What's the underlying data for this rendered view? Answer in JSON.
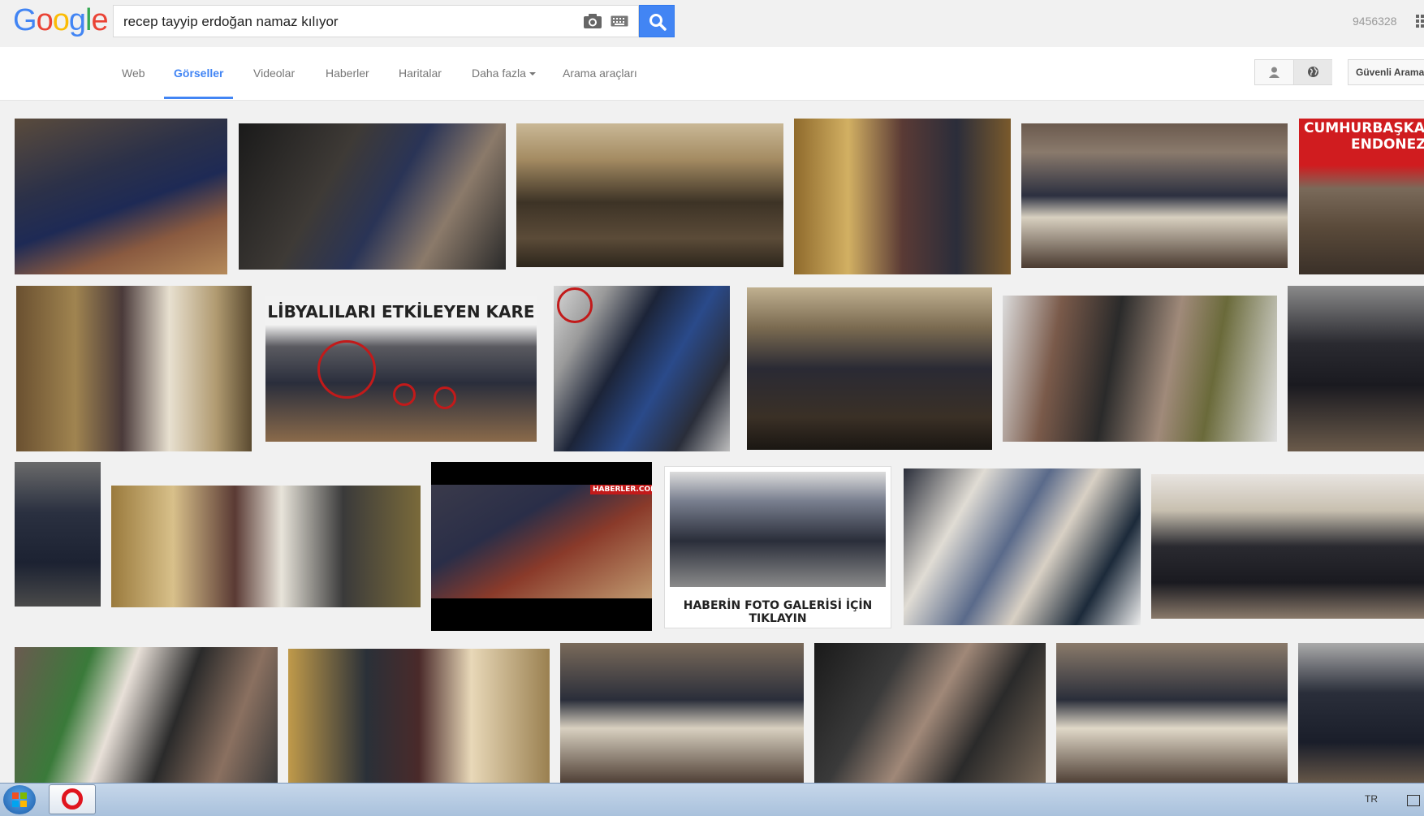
{
  "header": {
    "logo_letters": [
      {
        "ch": "G",
        "color": "#4285f4"
      },
      {
        "ch": "o",
        "color": "#ea4335"
      },
      {
        "ch": "o",
        "color": "#fbbc05"
      },
      {
        "ch": "g",
        "color": "#4285f4"
      },
      {
        "ch": "l",
        "color": "#34a853"
      },
      {
        "ch": "e",
        "color": "#ea4335"
      }
    ],
    "search_query": "recep tayyip erdoğan namaz kılıyor",
    "user_id": "9456328",
    "camera_icon": "camera-icon",
    "keyboard_icon": "keyboard-icon",
    "search_icon": "magnifier-icon"
  },
  "nav": {
    "web": "Web",
    "images": "Görseller",
    "videos": "Videolar",
    "news": "Haberler",
    "maps": "Haritalar",
    "more": "Daha fazla",
    "tools": "Arama araçları",
    "safe_search": "Güvenli Arama",
    "active_tab": "Görseller",
    "accent_color": "#4285f4"
  },
  "results": {
    "banners": {
      "cumhurbaskani_line1": "CUMHURBAŞKA",
      "cumhurbaskani_line2": "ENDONEZ",
      "libya": "LİBYALILARI ETKİLEYEN KARE",
      "haberler_logo": "HABERLER.COM",
      "galeri": "HABERİN FOTO GALERİSİ İÇİN TIKLAYIN"
    }
  },
  "taskbar": {
    "language": "TR",
    "start_icon": "windows-start-icon",
    "opera_icon": "opera-icon"
  }
}
